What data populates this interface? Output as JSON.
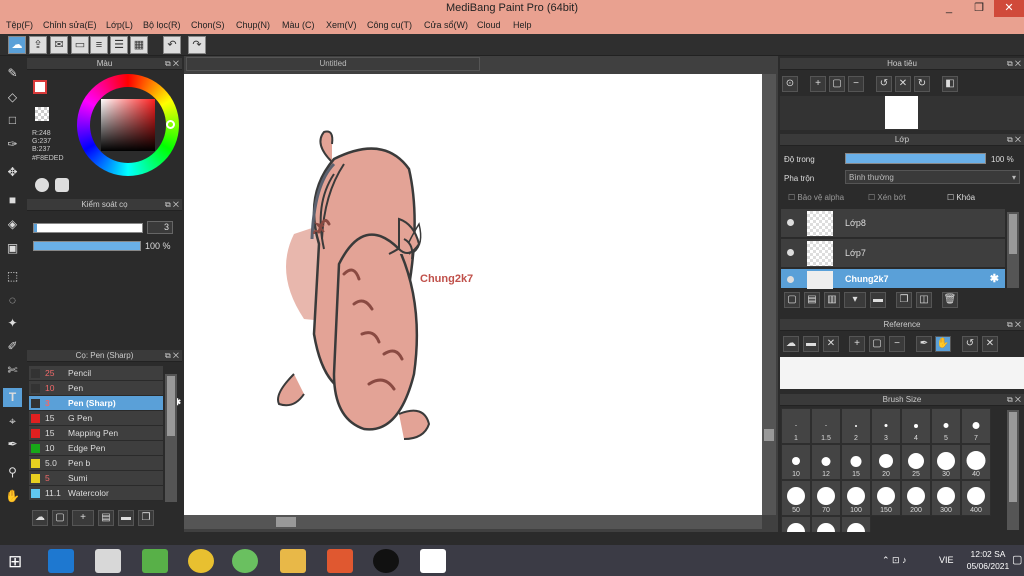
{
  "window": {
    "title": "MediBang Paint Pro (64bit)",
    "min": "_",
    "max": "❐",
    "close": "✕"
  },
  "menu": [
    "Tệp(F)",
    "Chỉnh sửa(E)",
    "Lớp(L)",
    "Bộ lọc(R)",
    "Chọn(S)",
    "Chụp(N)",
    "Màu (C)",
    "Xem(V)",
    "Công cụ(T)",
    "Cửa sổ(W)",
    "Cloud",
    "Help"
  ],
  "color_panel": {
    "title": "Màu",
    "r": "R:248",
    "g": "G:237",
    "b": "B:237",
    "hex": "#F8EDED",
    "accent": "#d83a3a"
  },
  "brush_control": {
    "title": "Kiểm soát cọ",
    "size": "3",
    "opacity": "100 %"
  },
  "brush_list": {
    "title": "Cọ: Pen (Sharp)",
    "items": [
      {
        "size": "25",
        "name": "Pencil",
        "color": "#333333"
      },
      {
        "size": "10",
        "name": "Pen",
        "color": "#333333"
      },
      {
        "size": "3",
        "name": "Pen (Sharp)",
        "color": "#333333"
      },
      {
        "size": "15",
        "name": "G Pen",
        "color": "#e02020"
      },
      {
        "size": "15",
        "name": "Mapping Pen",
        "color": "#e02020"
      },
      {
        "size": "10",
        "name": "Edge Pen",
        "color": "#18a818"
      },
      {
        "size": "5.0",
        "name": "Pen b",
        "color": "#e8d020"
      },
      {
        "size": "5",
        "name": "Sumi",
        "color": "#e8d020"
      },
      {
        "size": "11.1",
        "name": "Watercolor",
        "color": "#60c8f0"
      }
    ]
  },
  "canvas": {
    "tab": "Untitled",
    "text": "Chung2k7"
  },
  "navigator": {
    "title": "Hoa tiêu"
  },
  "layers": {
    "title": "Lớp",
    "opacity_label": "Độ trong",
    "opacity_value": "100 %",
    "blend_label": "Pha trộn",
    "blend_value": "Bình thường",
    "protect_alpha": "Bảo vệ alpha",
    "clip": "Xén bớt",
    "lock": "Khóa",
    "items": [
      {
        "name": "Lớp8"
      },
      {
        "name": "Lớp7"
      },
      {
        "name": "Chung2k7"
      }
    ]
  },
  "reference": {
    "title": "Reference"
  },
  "brush_size": {
    "title": "Brush Size",
    "sizes": [
      "1",
      "1.5",
      "2",
      "3",
      "4",
      "5",
      "7",
      "10",
      "12",
      "15",
      "20",
      "25",
      "30",
      "40",
      "50",
      "70",
      "100",
      "150",
      "200",
      "300",
      "400"
    ]
  },
  "taskbar": {
    "lang": "VIE",
    "time": "12:02 SA",
    "date": "05/06/2021"
  }
}
